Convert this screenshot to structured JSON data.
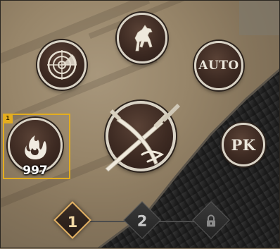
{
  "hud": {
    "quick_slot": {
      "badge": "1",
      "skill_icon": "flame-swirl-icon",
      "count": "997"
    },
    "buttons": {
      "mount_icon": "horse-icon",
      "radar_icon": "radar-icon",
      "auto_label": "AUTO",
      "attack_icon": "crossed-swords-icon",
      "pk_label": "PK"
    },
    "pages": [
      {
        "label": "1",
        "state": "active"
      },
      {
        "label": "2",
        "state": "inactive"
      },
      {
        "label": "",
        "state": "locked",
        "icon": "lock-icon"
      }
    ]
  },
  "colors": {
    "selection_accent": "#e3ad1e",
    "active_page_border": "#e2b062",
    "button_ring": "#d9d3c6"
  }
}
